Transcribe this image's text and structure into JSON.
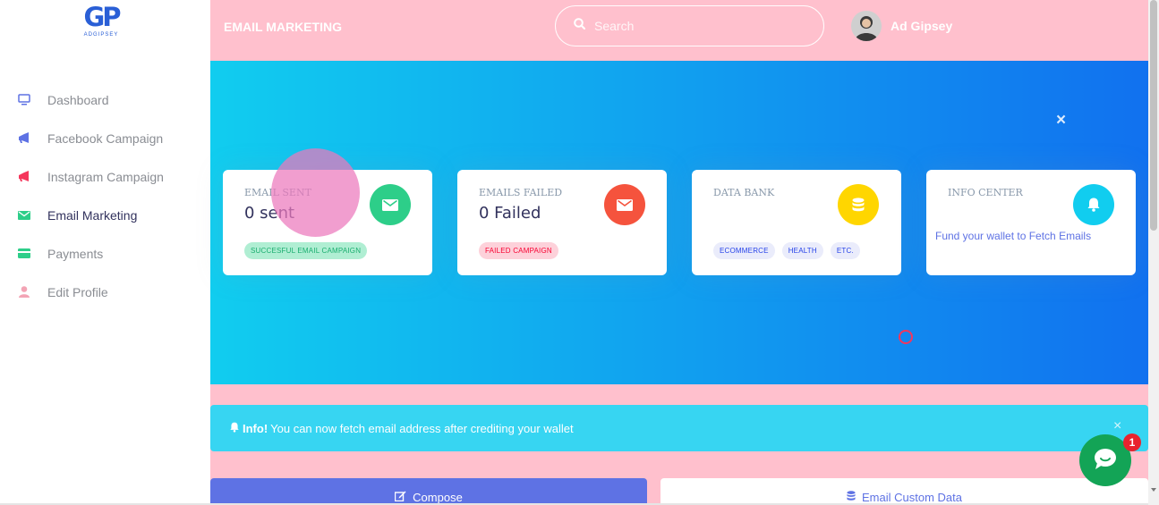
{
  "brand": {
    "logo_mark": "GP",
    "logo_text": "ADGIPSEY"
  },
  "sidebar": {
    "items": [
      {
        "label": "Dashboard",
        "icon": "monitor-icon",
        "color": "#5e72e4"
      },
      {
        "label": "Facebook Campaign",
        "icon": "megaphone-icon",
        "color": "#5e72e4"
      },
      {
        "label": "Instagram Campaign",
        "icon": "megaphone-icon",
        "color": "#f5365c"
      },
      {
        "label": "Email Marketing",
        "icon": "envelope-icon",
        "color": "#2dce89",
        "active": true
      },
      {
        "label": "Payments",
        "icon": "credit-card-icon",
        "color": "#2dce89"
      },
      {
        "label": "Edit Profile",
        "icon": "user-icon",
        "color": "#f3a4b5"
      }
    ]
  },
  "header": {
    "title": "EMAIL MARKETING",
    "search_placeholder": "Search",
    "user_name": "Ad Gipsey"
  },
  "cards": [
    {
      "title": "EMAIL SENT",
      "value": "0 sent",
      "badges": [
        "SUCCESFUL EMAIL CAMPAIGN"
      ],
      "icon": "envelope-icon",
      "icon_color": "#2dce89"
    },
    {
      "title": "EMAILS FAILED",
      "value": "0 Failed",
      "badges": [
        "FAILED CAMPAIGN"
      ],
      "icon": "envelope-icon",
      "icon_color": "#f5533d"
    },
    {
      "title": "DATA BANK",
      "value": "",
      "badges": [
        "ECOMMERCE",
        "HEALTH",
        "ETC."
      ],
      "icon": "database-icon",
      "icon_color": "#ffd600"
    },
    {
      "title": "INFO CENTER",
      "value": "",
      "text": "Fund your wallet to Fetch Emails",
      "icon": "bell-icon",
      "icon_color": "#11cdef"
    }
  ],
  "alert": {
    "strong": "Info!",
    "message": "You can now fetch email address after crediting your wallet",
    "close": "×"
  },
  "hero_close": "×",
  "buttons": {
    "compose": "Compose",
    "custom_data": "Email Custom Data"
  },
  "chat": {
    "badge_count": "1"
  },
  "colors": {
    "accent_pink": "#ffc0cd",
    "hero_gradient_start": "#11cdef",
    "hero_gradient_end": "#1171ef",
    "primary": "#5e72e4",
    "info": "#37d5f2"
  }
}
